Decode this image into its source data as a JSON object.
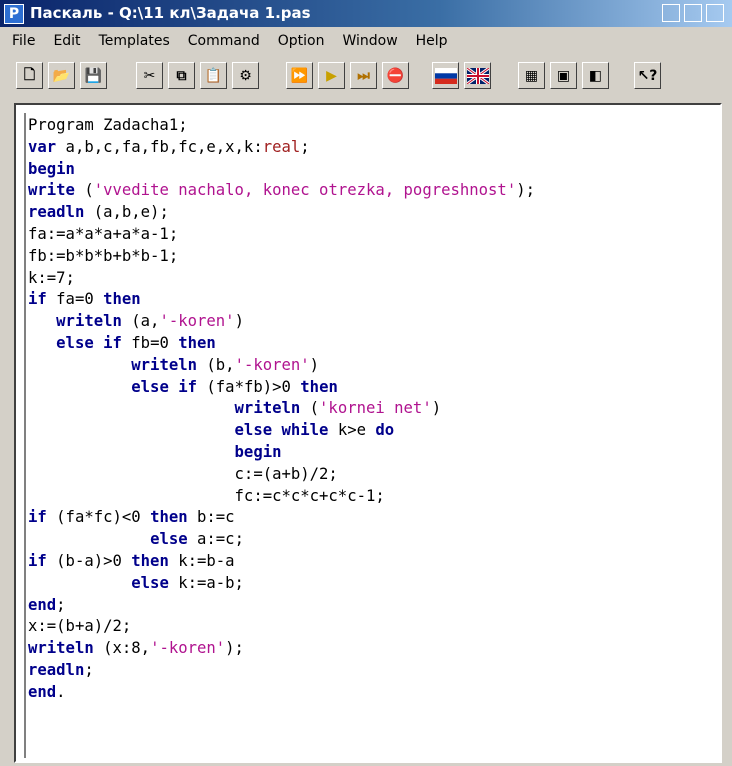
{
  "window": {
    "app_icon": "P",
    "title": "Паскаль - Q:\\11 кл\\Задача 1.pas"
  },
  "menu": [
    "File",
    "Edit",
    "Templates",
    "Command",
    "Option",
    "Window",
    "Help"
  ],
  "toolbar": {
    "buttons": [
      {
        "name": "new-icon",
        "glyph": "🗋"
      },
      {
        "name": "open-icon",
        "glyph": "📂"
      },
      {
        "name": "save-icon",
        "glyph": "💾"
      },
      {
        "name": "cut-icon",
        "glyph": "✂"
      },
      {
        "name": "copy-icon",
        "glyph": "⧉"
      },
      {
        "name": "paste-icon",
        "glyph": "📋"
      },
      {
        "name": "help-book-icon",
        "glyph": "⚙"
      },
      {
        "name": "run-to-icon",
        "glyph": "⏩"
      },
      {
        "name": "run-icon",
        "glyph": "▶"
      },
      {
        "name": "step-icon",
        "glyph": "⏭"
      },
      {
        "name": "stop-icon",
        "glyph": "⛔"
      },
      {
        "name": "russian-flag-icon",
        "glyph": ""
      },
      {
        "name": "uk-flag-icon",
        "glyph": ""
      },
      {
        "name": "window-icon-1",
        "glyph": "▦"
      },
      {
        "name": "window-icon-2",
        "glyph": "▣"
      },
      {
        "name": "window-icon-3",
        "glyph": "◧"
      },
      {
        "name": "context-help-icon",
        "glyph": "↖?"
      }
    ]
  },
  "code_lines": [
    [
      {
        "t": "Program Zadacha1;"
      }
    ],
    [
      {
        "t": "var",
        "c": "kw"
      },
      {
        "t": " a,b,c,fa,fb,fc,e,x,k:"
      },
      {
        "t": "real",
        "c": "ty"
      },
      {
        "t": ";"
      }
    ],
    [
      {
        "t": "begin",
        "c": "kw"
      }
    ],
    [
      {
        "t": "write",
        "c": "kw"
      },
      {
        "t": " ("
      },
      {
        "t": "'vvedite nachalo, konec otrezka, pogreshnost'",
        "c": "str"
      },
      {
        "t": ");"
      }
    ],
    [
      {
        "t": "readln",
        "c": "kw"
      },
      {
        "t": " (a,b,e);"
      }
    ],
    [
      {
        "t": "fa:=a*a*a+a*a-1;"
      }
    ],
    [
      {
        "t": "fb:=b*b*b+b*b-1;"
      }
    ],
    [
      {
        "t": "k:=7;"
      }
    ],
    [
      {
        "t": "if",
        "c": "kw"
      },
      {
        "t": " fa=0 "
      },
      {
        "t": "then",
        "c": "kw"
      }
    ],
    [
      {
        "t": "   "
      },
      {
        "t": "writeln",
        "c": "kw"
      },
      {
        "t": " (a,"
      },
      {
        "t": "'-koren'",
        "c": "str"
      },
      {
        "t": ")"
      }
    ],
    [
      {
        "t": "   "
      },
      {
        "t": "else",
        "c": "kw"
      },
      {
        "t": " "
      },
      {
        "t": "if",
        "c": "kw"
      },
      {
        "t": " fb=0 "
      },
      {
        "t": "then",
        "c": "kw"
      }
    ],
    [
      {
        "t": "           "
      },
      {
        "t": "writeln",
        "c": "kw"
      },
      {
        "t": " (b,"
      },
      {
        "t": "'-koren'",
        "c": "str"
      },
      {
        "t": ")"
      }
    ],
    [
      {
        "t": "           "
      },
      {
        "t": "else",
        "c": "kw"
      },
      {
        "t": " "
      },
      {
        "t": "if",
        "c": "kw"
      },
      {
        "t": " (fa*fb)>0 "
      },
      {
        "t": "then",
        "c": "kw"
      }
    ],
    [
      {
        "t": "                      "
      },
      {
        "t": "writeln",
        "c": "kw"
      },
      {
        "t": " ("
      },
      {
        "t": "'kornei net'",
        "c": "str"
      },
      {
        "t": ")"
      }
    ],
    [
      {
        "t": "                      "
      },
      {
        "t": "else",
        "c": "kw"
      },
      {
        "t": " "
      },
      {
        "t": "while",
        "c": "kw"
      },
      {
        "t": " k>e "
      },
      {
        "t": "do",
        "c": "kw"
      }
    ],
    [
      {
        "t": "                      "
      },
      {
        "t": "begin",
        "c": "kw"
      }
    ],
    [
      {
        "t": "                      c:=(a+b)/2;"
      }
    ],
    [
      {
        "t": "                      fc:=c*c*c+c*c-1;"
      }
    ],
    [
      {
        "t": "if",
        "c": "kw"
      },
      {
        "t": " (fa*fc)<0 "
      },
      {
        "t": "then",
        "c": "kw"
      },
      {
        "t": " b:=c"
      }
    ],
    [
      {
        "t": "             "
      },
      {
        "t": "else",
        "c": "kw"
      },
      {
        "t": " a:=c;"
      }
    ],
    [
      {
        "t": "if",
        "c": "kw"
      },
      {
        "t": " (b-a)>0 "
      },
      {
        "t": "then",
        "c": "kw"
      },
      {
        "t": " k:=b-a"
      }
    ],
    [
      {
        "t": "           "
      },
      {
        "t": "else",
        "c": "kw"
      },
      {
        "t": " k:=a-b;"
      }
    ],
    [
      {
        "t": "end",
        "c": "kw"
      },
      {
        "t": ";"
      }
    ],
    [
      {
        "t": "x:=(b+a)/2;"
      }
    ],
    [
      {
        "t": "writeln",
        "c": "kw"
      },
      {
        "t": " (x:8,"
      },
      {
        "t": "'-koren'",
        "c": "str"
      },
      {
        "t": ");"
      }
    ],
    [
      {
        "t": "readln",
        "c": "kw"
      },
      {
        "t": ";"
      }
    ],
    [
      {
        "t": "end",
        "c": "kw"
      },
      {
        "t": "."
      }
    ]
  ]
}
